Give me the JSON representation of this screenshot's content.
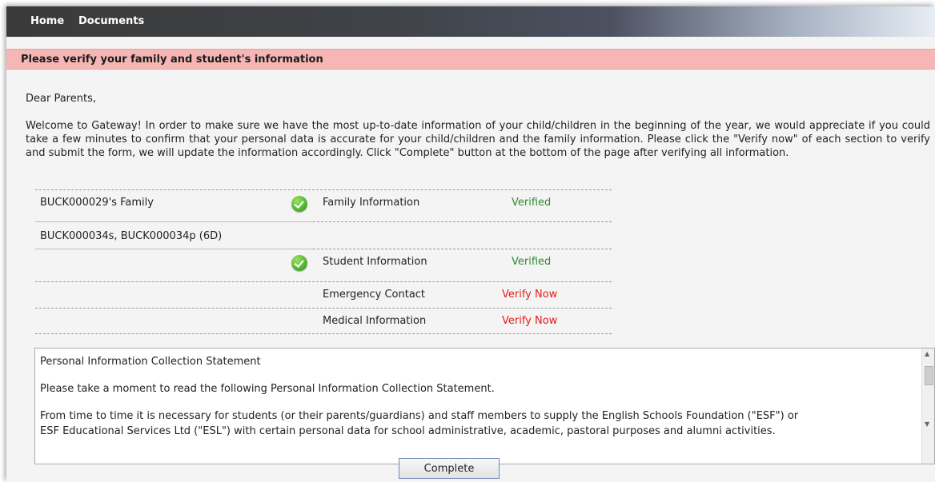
{
  "nav": {
    "home": "Home",
    "documents": "Documents"
  },
  "banner": {
    "title": "Please verify your family and student's information"
  },
  "letter": {
    "greeting": "Dear Parents,",
    "intro": "Welcome to Gateway! In order to make sure we have the most up-to-date information of your child/children in the beginning of the year, we would appreciate if you could take a few minutes to confirm that your personal data is accurate for your child/children and the family information. Please click the \"Verify now\" of each section to verify and submit the form, we will update the information accordingly. Click \"Complete\" button at the bottom of the page after verifying all information."
  },
  "verification": {
    "family": {
      "name": "BUCK000029's Family",
      "section": "Family Information",
      "status": "Verified"
    },
    "student_label": "BUCK000034s, BUCK000034p (6D)",
    "student_sections": [
      {
        "section": "Student Information",
        "status": "Verified"
      },
      {
        "section": "Emergency Contact",
        "status": "Verify Now"
      },
      {
        "section": "Medical Information",
        "status": "Verify Now"
      }
    ]
  },
  "statement": {
    "heading": "Personal Information Collection Statement",
    "line1": "Please take a moment to read the following Personal Information Collection Statement.",
    "line2": "From time to time it is necessary for students (or their parents/guardians) and staff members to supply the English Schools Foundation (\"ESF\") or",
    "line3": "ESF Educational Services Ltd (\"ESL\") with certain personal data for school administrative, academic, pastoral purposes and alumni activities."
  },
  "footer": {
    "complete_label": "Complete"
  },
  "colors": {
    "banner_bg": "#f7b6b6",
    "verified": "#2f8a2f",
    "verify_now": "#e31b1b"
  }
}
